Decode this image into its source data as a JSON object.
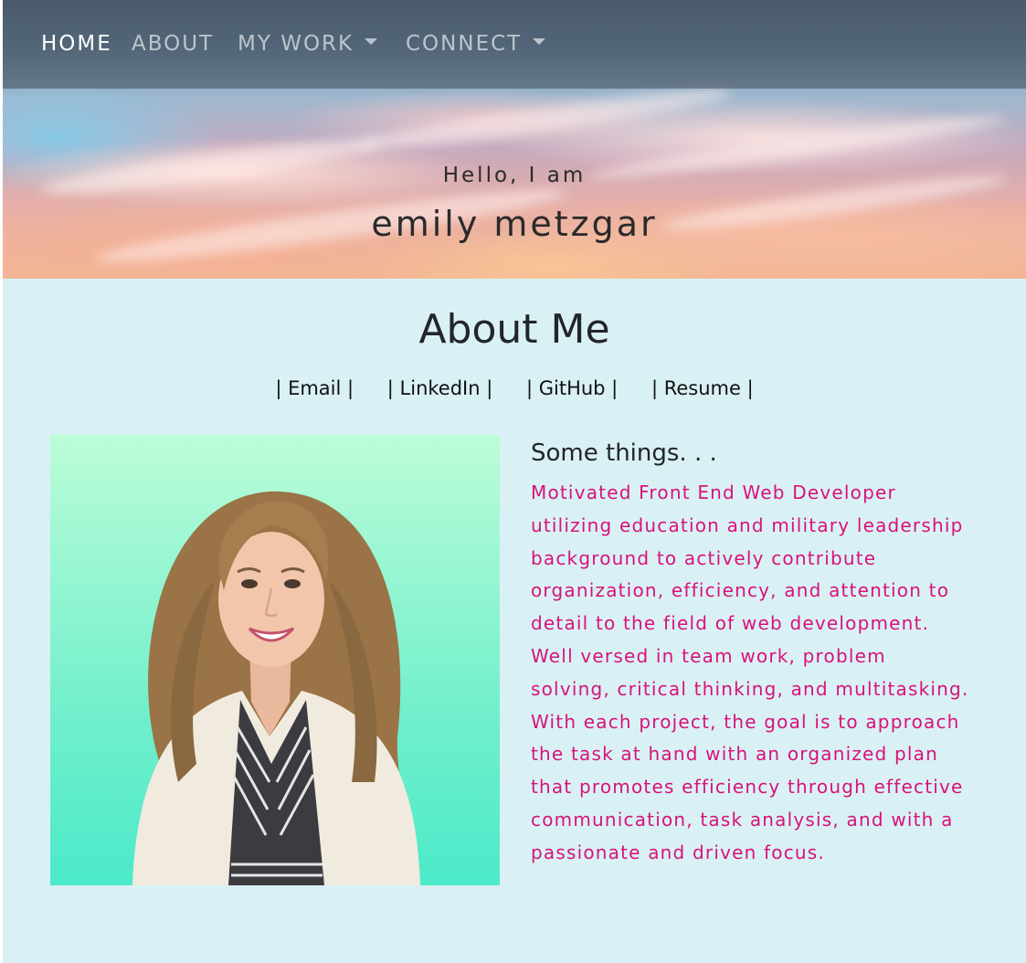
{
  "nav": {
    "items": [
      {
        "label": "HOME",
        "active": true
      },
      {
        "label": "ABOUT",
        "active": false
      },
      {
        "label": "MY WORK",
        "active": false,
        "dropdown": true
      },
      {
        "label": "CONNECT",
        "active": false,
        "dropdown": true
      }
    ]
  },
  "hero": {
    "greeting": "Hello, I am",
    "name": "emily metzgar"
  },
  "about": {
    "title": "About Me",
    "links": [
      {
        "label": "| Email |"
      },
      {
        "label": "| LinkedIn |"
      },
      {
        "label": "| GitHub |"
      },
      {
        "label": "| Resume |"
      }
    ],
    "heading": "Some things. . .",
    "bio": "Motivated Front End Web Developer utilizing education and military leadership background to actively contribute organization, efficiency, and attention to detail to the field of web development. Well versed in team work, problem solving, critical thinking, and multitasking. With each project, the goal is to approach the task at hand with an organized plan that promotes efficiency through effective communication, task analysis, and with a passionate and driven focus."
  },
  "colors": {
    "page_background": "#d9f1f5",
    "bio_text": "#d9127a",
    "photo_background": "#6eeecb"
  }
}
